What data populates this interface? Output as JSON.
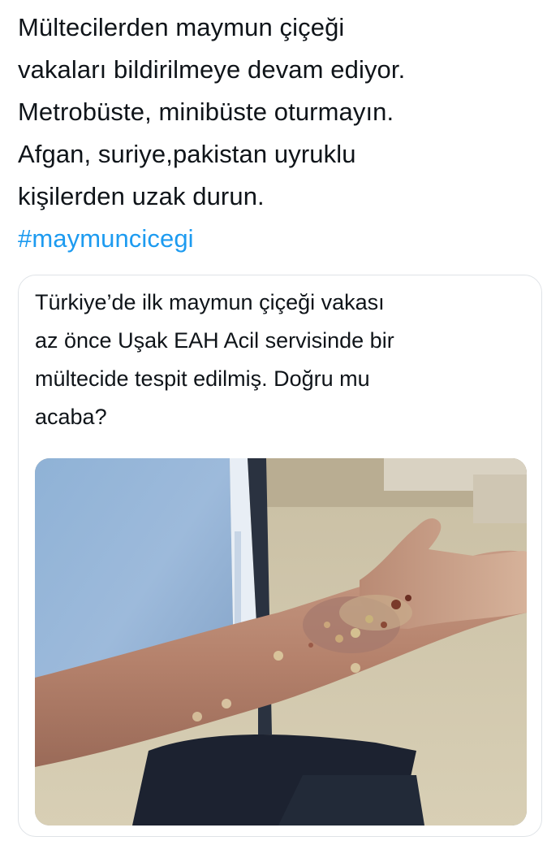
{
  "tweet": {
    "text_lines": [
      "Mültecilerden maymun çiçeği",
      "vakaları bildirilmeye devam ediyor.",
      "Metrobüste, minibüste oturmayın.",
      "Afgan, suriye,pakistan uyruklu",
      "kişilerden uzak durun."
    ],
    "hashtag": "#maymuncicegi"
  },
  "quote": {
    "text_lines": [
      "Türkiye’de ilk maymun çiçeği vakası",
      "az önce Uşak EAH Acil servisinde bir",
      "mültecide tespit edilmiş. Doğru mu",
      "acaba?"
    ]
  },
  "colors": {
    "text": "#0f1419",
    "link": "#1d9bf0",
    "border": "#dfe3e7"
  }
}
